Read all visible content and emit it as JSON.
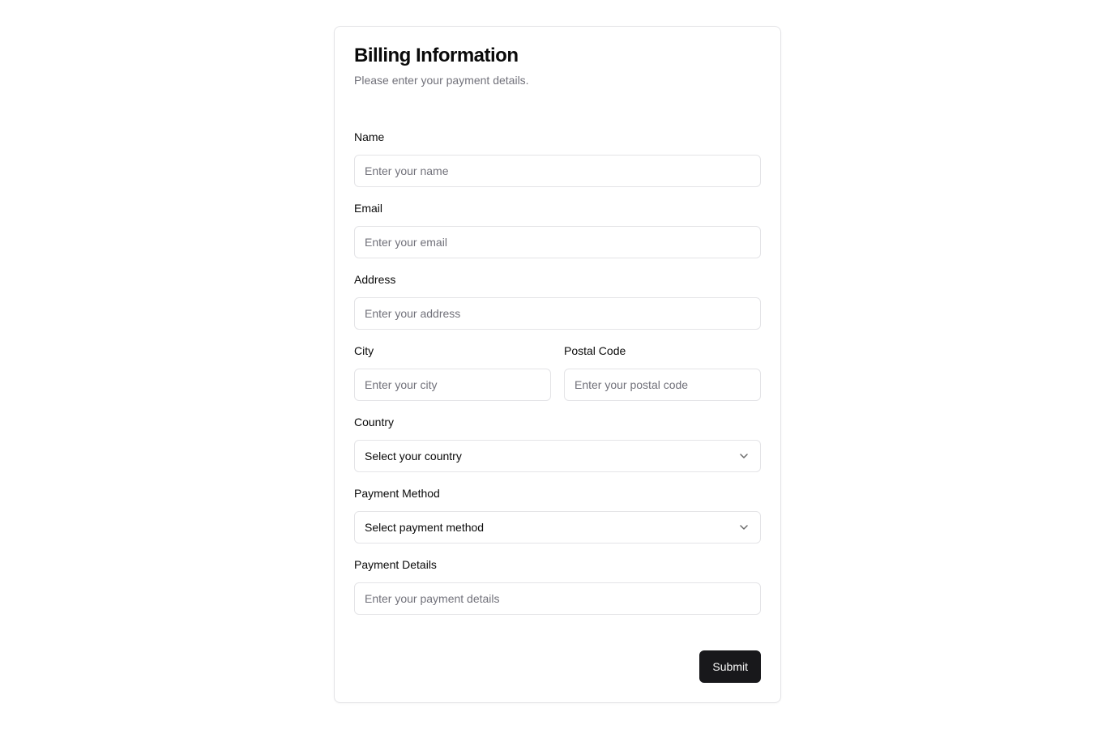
{
  "form": {
    "title": "Billing Information",
    "subtitle": "Please enter your payment details.",
    "fields": {
      "name": {
        "label": "Name",
        "placeholder": "Enter your name",
        "value": ""
      },
      "email": {
        "label": "Email",
        "placeholder": "Enter your email",
        "value": ""
      },
      "address": {
        "label": "Address",
        "placeholder": "Enter your address",
        "value": ""
      },
      "city": {
        "label": "City",
        "placeholder": "Enter your city",
        "value": ""
      },
      "postal_code": {
        "label": "Postal Code",
        "placeholder": "Enter your postal code",
        "value": ""
      },
      "country": {
        "label": "Country",
        "selected": "Select your country",
        "icon": "chevron-down-icon"
      },
      "payment_method": {
        "label": "Payment Method",
        "selected": "Select payment method",
        "icon": "chevron-down-icon"
      },
      "payment_details": {
        "label": "Payment Details",
        "placeholder": "Enter your payment details",
        "value": ""
      }
    },
    "submit_label": "Submit"
  },
  "colors": {
    "primary_button": "#18181b",
    "border": "#e4e4e7",
    "muted_text": "#71717a"
  }
}
